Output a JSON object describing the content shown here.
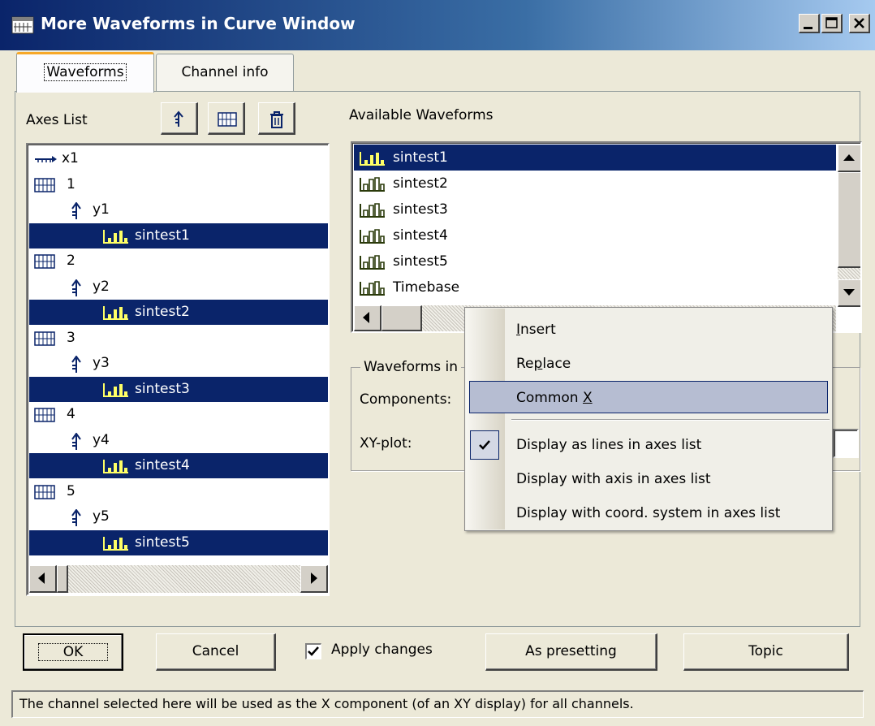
{
  "window": {
    "title": "More Waveforms in Curve Window",
    "controls": [
      "minimize",
      "maximize",
      "close"
    ]
  },
  "tabs": [
    {
      "label": "Waveforms",
      "active": true
    },
    {
      "label": "Channel info",
      "active": false
    }
  ],
  "axes_list": {
    "label": "Axes List",
    "toolbar_icons": [
      "axis-arrow-icon",
      "coord-system-icon",
      "trash-icon"
    ],
    "items": [
      {
        "label": "x1",
        "icon": "x-axis-icon",
        "level": 0,
        "selected": false
      },
      {
        "label": "1",
        "icon": "coord-system-icon",
        "level": 0,
        "selected": false
      },
      {
        "label": "y1",
        "icon": "y-axis-icon",
        "level": 1,
        "selected": false
      },
      {
        "label": "sintest1",
        "icon": "waveform-icon",
        "level": 2,
        "selected": true
      },
      {
        "label": "2",
        "icon": "coord-system-icon",
        "level": 0,
        "selected": false
      },
      {
        "label": "y2",
        "icon": "y-axis-icon",
        "level": 1,
        "selected": false
      },
      {
        "label": "sintest2",
        "icon": "waveform-icon",
        "level": 2,
        "selected": true
      },
      {
        "label": "3",
        "icon": "coord-system-icon",
        "level": 0,
        "selected": false
      },
      {
        "label": "y3",
        "icon": "y-axis-icon",
        "level": 1,
        "selected": false
      },
      {
        "label": "sintest3",
        "icon": "waveform-icon",
        "level": 2,
        "selected": true
      },
      {
        "label": "4",
        "icon": "coord-system-icon",
        "level": 0,
        "selected": false
      },
      {
        "label": "y4",
        "icon": "y-axis-icon",
        "level": 1,
        "selected": false
      },
      {
        "label": "sintest4",
        "icon": "waveform-icon",
        "level": 2,
        "selected": true
      },
      {
        "label": "5",
        "icon": "coord-system-icon",
        "level": 0,
        "selected": false
      },
      {
        "label": "y5",
        "icon": "y-axis-icon",
        "level": 1,
        "selected": false
      },
      {
        "label": "sintest5",
        "icon": "waveform-icon",
        "level": 2,
        "selected": true
      }
    ]
  },
  "available_waveforms": {
    "label": "Available Waveforms",
    "items": [
      {
        "label": "sintest1",
        "selected": true
      },
      {
        "label": "sintest2",
        "selected": false
      },
      {
        "label": "sintest3",
        "selected": false
      },
      {
        "label": "sintest4",
        "selected": false
      },
      {
        "label": "sintest5",
        "selected": false
      },
      {
        "label": "Timebase",
        "selected": false
      }
    ]
  },
  "group": {
    "legend": "Waveforms in",
    "components_label": "Components:",
    "xyplot_label": "XY-plot:"
  },
  "context_menu": {
    "items": [
      {
        "label_pre": "",
        "accel": "I",
        "label_post": "nsert",
        "highlighted": false,
        "checked": false
      },
      {
        "label_pre": "Re",
        "accel": "p",
        "label_post": "lace",
        "highlighted": false,
        "checked": false
      },
      {
        "label_pre": "Common ",
        "accel": "X",
        "label_post": "",
        "highlighted": true,
        "checked": false
      },
      {
        "label_pre": "Display as lines in axes list",
        "accel": "",
        "label_post": "",
        "highlighted": false,
        "checked": true
      },
      {
        "label_pre": "Display with axis in axes list",
        "accel": "",
        "label_post": "",
        "highlighted": false,
        "checked": false
      },
      {
        "label_pre": "Display with coord. system in axes list",
        "accel": "",
        "label_post": "",
        "highlighted": false,
        "checked": false
      }
    ]
  },
  "buttons": {
    "ok": "OK",
    "cancel": "Cancel",
    "apply_changes": "Apply changes",
    "apply_checked": true,
    "as_presetting": "As presetting",
    "topic": "Topic"
  },
  "status_text": "The channel selected here will be used as the X component (of an XY display) for all channels.",
  "colors": {
    "selection": "#0a246a",
    "face": "#ece9d8",
    "menu_highlight": "#b6bdd2"
  }
}
